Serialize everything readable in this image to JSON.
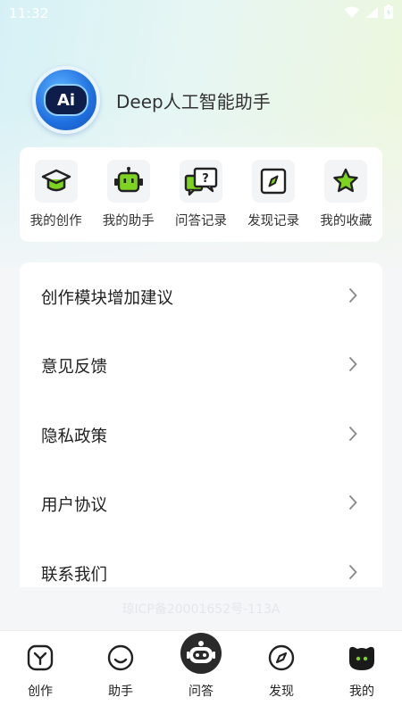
{
  "status_bar": {
    "time": "11:32",
    "icons": [
      "wifi-icon",
      "signal-icon",
      "battery-icon"
    ]
  },
  "profile": {
    "avatar_text": "Ai",
    "app_name": "Deep人工智能助手"
  },
  "quick_actions": [
    {
      "label": "我的创作",
      "icon": "graduation-cap-icon"
    },
    {
      "label": "我的助手",
      "icon": "robot-icon"
    },
    {
      "label": "问答记录",
      "icon": "qa-bubbles-icon"
    },
    {
      "label": "发现记录",
      "icon": "compass-icon"
    },
    {
      "label": "我的收藏",
      "icon": "star-icon"
    }
  ],
  "settings": [
    {
      "label": "创作模块增加建议",
      "icon": "chevron-right-icon"
    },
    {
      "label": "意见反馈",
      "icon": "chevron-right-icon"
    },
    {
      "label": "隐私政策",
      "icon": "chevron-right-icon"
    },
    {
      "label": "用户协议",
      "icon": "chevron-right-icon"
    },
    {
      "label": "联系我们",
      "icon": "chevron-right-icon"
    }
  ],
  "footer": {
    "icp": "琼ICP备20001652号-113A"
  },
  "bottom_nav": [
    {
      "label": "创作",
      "icon": "create-icon"
    },
    {
      "label": "助手",
      "icon": "smile-icon"
    },
    {
      "label": "问答",
      "icon": "robot-face-icon"
    },
    {
      "label": "发现",
      "icon": "compass-icon"
    },
    {
      "label": "我的",
      "icon": "profile-face-icon",
      "active": true
    }
  ],
  "colors": {
    "accent_green": "#7ed321",
    "page_background": "#f4f6f8",
    "card_background": "#ffffff",
    "avatar_blue": "#1f6fe0"
  }
}
